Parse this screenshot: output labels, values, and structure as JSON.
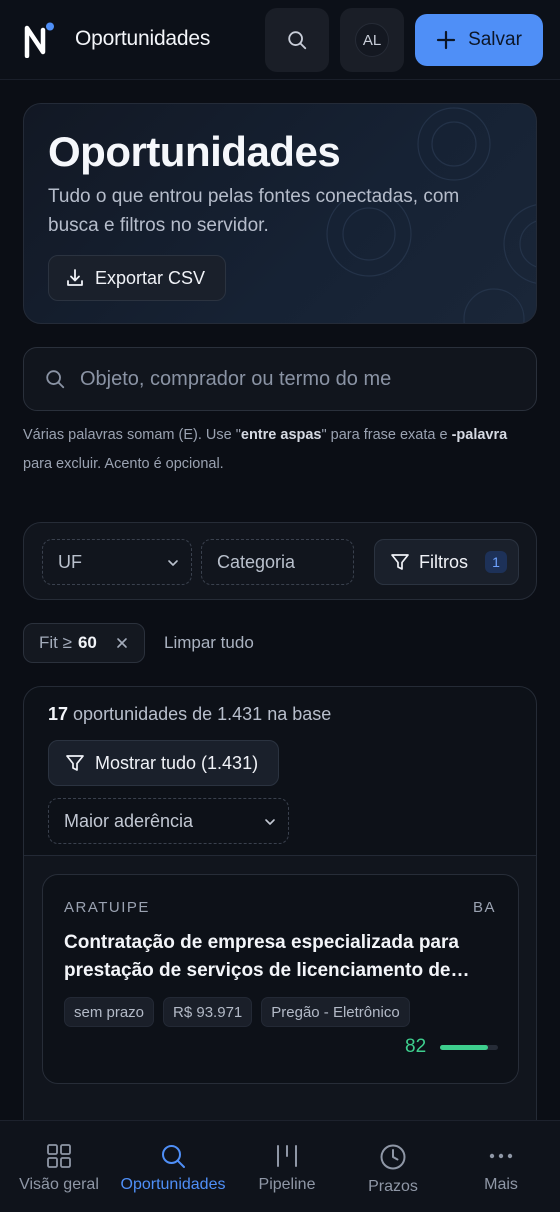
{
  "header": {
    "app_title": "Oportunidades",
    "avatar_initials": "AL",
    "save_label": "Salvar",
    "logo_letter": "N"
  },
  "hero": {
    "title": "Oportunidades",
    "subtitle": "Tudo o que entrou pelas fontes conectadas, com busca e filtros no servidor.",
    "export_label": "Exportar CSV"
  },
  "search": {
    "placeholder": "Objeto, comprador ou termo do me",
    "value": "",
    "hint_1": "Várias palavras somam (E). Use \"",
    "hint_bold_1": "entre aspas",
    "hint_2": "\" para frase exata e ",
    "hint_bold_2": "-palavra",
    "hint_3": " para excluir. Acento é opcional."
  },
  "filters": {
    "uf_label": "UF",
    "category_label": "Categoria",
    "filters_label": "Filtros",
    "filters_count": "1"
  },
  "active_chips": [
    {
      "label": "Fit ≥",
      "value": "60"
    }
  ],
  "clear_all_label": "Limpar tudo",
  "results": {
    "count": "17",
    "count_text": " oportunidades de 1.431 na base",
    "show_all_label": "Mostrar tudo (1.431)",
    "sort_label": "Maior aderência"
  },
  "cards": [
    {
      "city": "ARATUIPE",
      "uf": "BA",
      "title": "Contratação de empresa especializada para prestação de serviços de licenciamento de software",
      "tags": [
        "sem prazo",
        "R$ 93.971",
        "Pregão - Eletrônico"
      ],
      "fit": "82",
      "fit_fraction": 0.82
    }
  ],
  "nav": [
    {
      "label": "Visão geral",
      "icon": "grid-icon"
    },
    {
      "label": "Oportunidades",
      "icon": "search-icon",
      "active": true
    },
    {
      "label": "Pipeline",
      "icon": "pipeline-icon"
    },
    {
      "label": "Prazos",
      "icon": "clock-icon"
    },
    {
      "label": "Mais",
      "icon": "more-icon"
    }
  ],
  "colors": {
    "accent": "#4f8ff7",
    "fit_good": "#3ecf8e",
    "background": "#0b0e15"
  }
}
